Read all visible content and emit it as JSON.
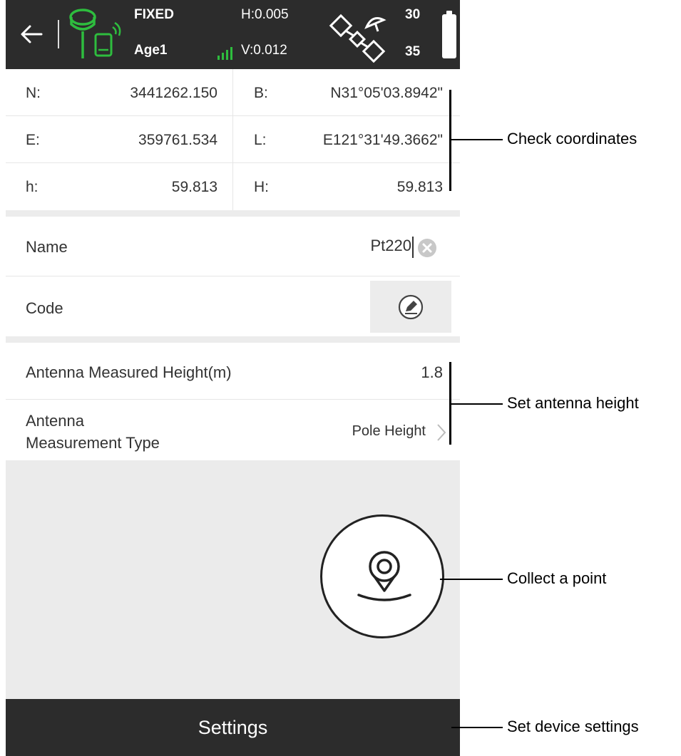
{
  "status": {
    "fix": "FIXED",
    "age": "Age1",
    "h_precision": "H:0.005",
    "v_precision": "V:0.012",
    "sats_used": "30",
    "sats_visible": "35",
    "colors": {
      "bar": "#2c2c2c",
      "receiver": "#2ebd3e"
    },
    "icons": [
      "back-arrow-icon",
      "receiver-icon",
      "signal-icon",
      "satellite-icon",
      "battery-icon"
    ]
  },
  "coordinates": {
    "rows": [
      {
        "l1": "N:",
        "v1": "3441262.150",
        "l2": "B:",
        "v2": "N31°05'03.8942\""
      },
      {
        "l1": "E:",
        "v1": "359761.534",
        "l2": "L:",
        "v2": "E121°31'49.3662\""
      },
      {
        "l1": "h:",
        "v1": "59.813",
        "l2": "H:",
        "v2": "59.813"
      }
    ]
  },
  "form": {
    "name_label": "Name",
    "name_value": "Pt220",
    "code_label": "Code",
    "antenna_height_label": "Antenna Measured Height(m)",
    "antenna_height_value": "1.8",
    "antenna_type_label_1": "Antenna",
    "antenna_type_label_2": "Measurement Type",
    "antenna_type_value": "Pole Height"
  },
  "footer": {
    "settings_label": "Settings"
  },
  "annotations": {
    "check_coordinates": "Check coordinates",
    "set_antenna_height": "Set antenna height",
    "collect_point": "Collect a point",
    "set_device_settings": "Set device settings"
  }
}
